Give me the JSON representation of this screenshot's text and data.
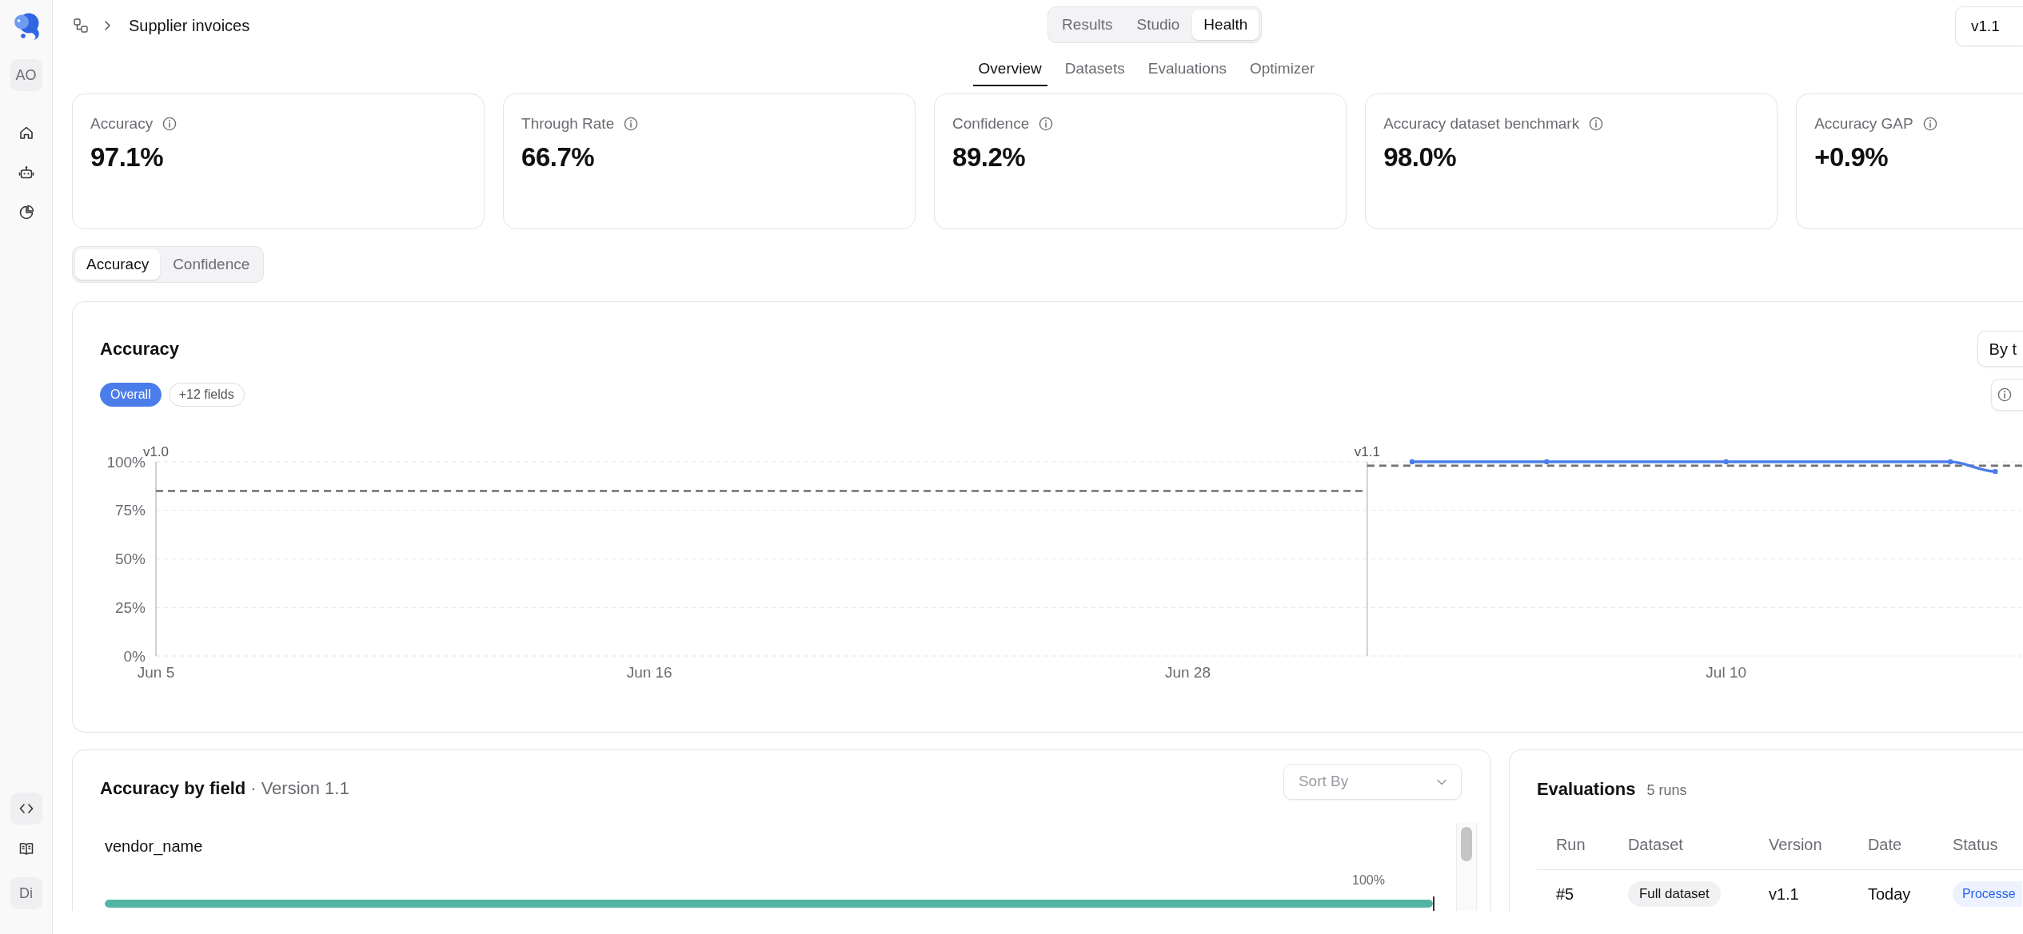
{
  "sidebar": {
    "workspace_avatar": "AO",
    "user_avatar": "Di"
  },
  "breadcrumb": {
    "title": "Supplier invoices"
  },
  "view_switch": [
    {
      "label": "Results",
      "selected": false
    },
    {
      "label": "Studio",
      "selected": false
    },
    {
      "label": "Health",
      "selected": true
    }
  ],
  "version_select": {
    "value": "v1.1"
  },
  "tabs": [
    {
      "label": "Overview",
      "selected": true
    },
    {
      "label": "Datasets",
      "selected": false
    },
    {
      "label": "Evaluations",
      "selected": false
    },
    {
      "label": "Optimizer",
      "selected": false
    }
  ],
  "metrics": [
    {
      "label": "Accuracy",
      "value": "97.1%"
    },
    {
      "label": "Through Rate",
      "value": "66.7%"
    },
    {
      "label": "Confidence",
      "value": "89.2%"
    },
    {
      "label": "Accuracy dataset benchmark",
      "value": "98.0%"
    },
    {
      "label": "Accuracy GAP",
      "value": "+0.9%"
    }
  ],
  "metric_toggle": [
    {
      "label": "Accuracy",
      "selected": true
    },
    {
      "label": "Confidence",
      "selected": false
    }
  ],
  "chart_panel": {
    "group_by_button": "By t",
    "filters": [
      {
        "label": "Overall",
        "selected": true
      },
      {
        "label": "+12 fields",
        "selected": false
      }
    ],
    "versions": [
      {
        "label": "v1.0"
      },
      {
        "label": "v1.1"
      }
    ],
    "chart_data": {
      "type": "line",
      "title": "Accuracy",
      "grid": true,
      "categories": [
        "Jun 5",
        null,
        null,
        null,
        null,
        null,
        null,
        null,
        null,
        null,
        null,
        "Jun 16",
        null,
        null,
        null,
        null,
        null,
        null,
        null,
        null,
        null,
        null,
        null,
        "Jun 28",
        null,
        null,
        null,
        null,
        null,
        null,
        null,
        null,
        null,
        null,
        null,
        "Jul 10",
        null,
        null,
        null,
        null,
        null,
        null
      ],
      "series": [
        {
          "color": "#4a7cea",
          "marker": "circle",
          "values": [
            null,
            null,
            null,
            null,
            null,
            null,
            null,
            null,
            null,
            null,
            null,
            null,
            null,
            null,
            null,
            null,
            null,
            null,
            null,
            null,
            null,
            null,
            null,
            null,
            null,
            null,
            null,
            null,
            100,
            null,
            null,
            100,
            null,
            null,
            null,
            100,
            null,
            null,
            null,
            null,
            100,
            95
          ]
        }
      ],
      "ylim": [
        0,
        100
      ],
      "yticks": [
        {
          "value": 0,
          "label": "0%"
        },
        {
          "value": 25,
          "label": "25%"
        },
        {
          "value": 50,
          "label": "50%"
        },
        {
          "value": 75,
          "label": "75%"
        },
        {
          "value": 100,
          "label": "100%"
        }
      ],
      "ref_lines": [
        {
          "axis": "y",
          "value": 85
        },
        {
          "axis": "y",
          "value": 98
        }
      ]
    }
  },
  "field_accuracy": {
    "title": "Accuracy by field",
    "subtitle": "· Version 1.1",
    "sort": {
      "placeholder": "Sort By"
    },
    "fields": [
      {
        "name": "vendor_name",
        "reading": "100%",
        "level": 1
      }
    ]
  },
  "evaluations": {
    "title": "Evaluations",
    "count": "5 runs",
    "columns": [
      "Run",
      "Dataset",
      "Version",
      "Date",
      "Status"
    ],
    "rows": [
      {
        "run": "#5",
        "dataset": "Full dataset",
        "version": "v1.1",
        "date": "Today",
        "status": "Processe"
      }
    ]
  }
}
